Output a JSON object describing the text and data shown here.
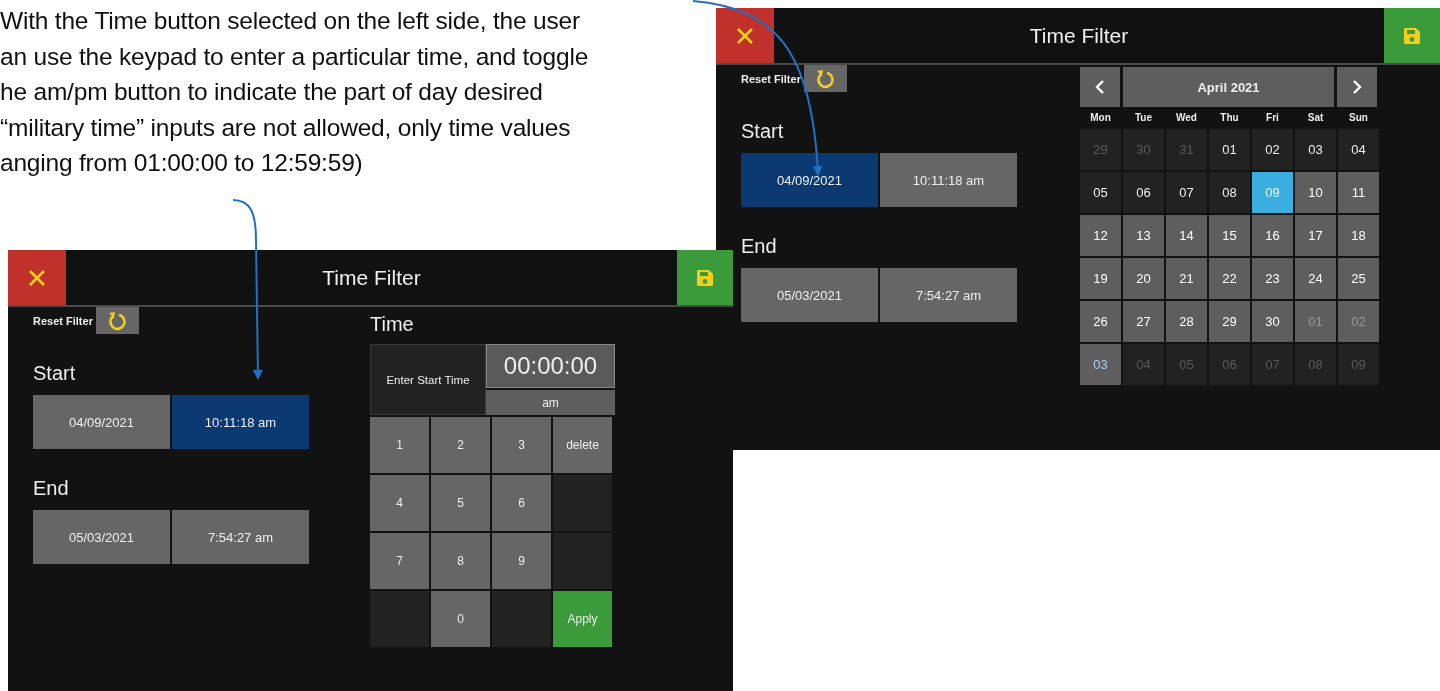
{
  "caption": {
    "lines": [
      "With the Time button selected on the left side, the user",
      "an use the keypad to enter a particular time, and toggle",
      "he am/pm button to indicate the part of day desired",
      "“military time” inputs are not allowed, only time values",
      "anging from 01:00:00 to 12:59:59)"
    ]
  },
  "screens": [
    {
      "kind": "calendar",
      "title": "Time Filter",
      "reset_label": "Reset Filter",
      "start_label": "Start",
      "start": {
        "date": {
          "text": "04/09/2021",
          "selected": true
        },
        "time": {
          "text": "10:11:18 am",
          "selected": false
        }
      },
      "end_label": "End",
      "end": {
        "date": {
          "text": "05/03/2021",
          "selected": false
        },
        "time": {
          "text": "7:54:27 am",
          "selected": false
        }
      },
      "calendar": {
        "month": "April 2021",
        "weekdays": [
          "Mon",
          "Tue",
          "Wed",
          "Thu",
          "Fri",
          "Sat",
          "Sun"
        ],
        "days": [
          {
            "label": "29",
            "kind": "outside",
            "selected": false
          },
          {
            "label": "30",
            "kind": "outside",
            "selected": false
          },
          {
            "label": "31",
            "kind": "outside",
            "selected": false
          },
          {
            "label": "01",
            "kind": "before",
            "selected": false
          },
          {
            "label": "02",
            "kind": "before",
            "selected": false
          },
          {
            "label": "03",
            "kind": "before",
            "selected": false
          },
          {
            "label": "04",
            "kind": "before",
            "selected": false
          },
          {
            "label": "05",
            "kind": "before",
            "selected": false
          },
          {
            "label": "06",
            "kind": "before",
            "selected": false
          },
          {
            "label": "07",
            "kind": "before",
            "selected": false
          },
          {
            "label": "08",
            "kind": "before",
            "selected": false
          },
          {
            "label": "09",
            "kind": "range",
            "selected": true
          },
          {
            "label": "10",
            "kind": "range",
            "selected": false
          },
          {
            "label": "11",
            "kind": "range",
            "selected": false
          },
          {
            "label": "12",
            "kind": "range",
            "selected": false
          },
          {
            "label": "13",
            "kind": "range",
            "selected": false
          },
          {
            "label": "14",
            "kind": "range",
            "selected": false
          },
          {
            "label": "15",
            "kind": "range",
            "selected": false
          },
          {
            "label": "16",
            "kind": "range",
            "selected": false
          },
          {
            "label": "17",
            "kind": "range",
            "selected": false
          },
          {
            "label": "18",
            "kind": "range",
            "selected": false
          },
          {
            "label": "19",
            "kind": "range",
            "selected": false
          },
          {
            "label": "20",
            "kind": "range",
            "selected": false
          },
          {
            "label": "21",
            "kind": "range",
            "selected": false
          },
          {
            "label": "22",
            "kind": "range",
            "selected": false
          },
          {
            "label": "23",
            "kind": "range",
            "selected": false
          },
          {
            "label": "24",
            "kind": "range",
            "selected": false
          },
          {
            "label": "25",
            "kind": "range",
            "selected": false
          },
          {
            "label": "26",
            "kind": "range",
            "selected": false
          },
          {
            "label": "27",
            "kind": "range",
            "selected": false
          },
          {
            "label": "28",
            "kind": "range",
            "selected": false
          },
          {
            "label": "29",
            "kind": "range",
            "selected": false
          },
          {
            "label": "30",
            "kind": "range",
            "selected": false
          },
          {
            "label": "01",
            "kind": "range-outside",
            "selected": false
          },
          {
            "label": "02",
            "kind": "range-outside",
            "selected": false
          },
          {
            "label": "03",
            "kind": "range-end",
            "selected": false
          },
          {
            "label": "04",
            "kind": "outside",
            "selected": false
          },
          {
            "label": "05",
            "kind": "outside",
            "selected": false
          },
          {
            "label": "06",
            "kind": "outside",
            "selected": false
          },
          {
            "label": "07",
            "kind": "outside",
            "selected": false
          },
          {
            "label": "08",
            "kind": "outside",
            "selected": false
          },
          {
            "label": "09",
            "kind": "outside",
            "selected": false
          }
        ]
      }
    },
    {
      "kind": "keypad",
      "title": "Time Filter",
      "reset_label": "Reset Filter",
      "start_label": "Start",
      "start": {
        "date": {
          "text": "04/09/2021",
          "selected": false
        },
        "time": {
          "text": "10:11:18 am",
          "selected": true
        }
      },
      "end_label": "End",
      "end": {
        "date": {
          "text": "05/03/2021",
          "selected": false
        },
        "time": {
          "text": "7:54:27 am",
          "selected": false
        }
      },
      "keypad": {
        "heading": "Time",
        "prompt": "Enter Start Time",
        "display": "00:00:00",
        "ampm": "am",
        "keys": [
          {
            "kind": "digit",
            "label": "1"
          },
          {
            "kind": "digit",
            "label": "2"
          },
          {
            "kind": "digit",
            "label": "3"
          },
          {
            "kind": "delete",
            "label": "delete"
          },
          {
            "kind": "digit",
            "label": "4"
          },
          {
            "kind": "digit",
            "label": "5"
          },
          {
            "kind": "digit",
            "label": "6"
          },
          {
            "kind": "blank"
          },
          {
            "kind": "digit",
            "label": "7"
          },
          {
            "kind": "digit",
            "label": "8"
          },
          {
            "kind": "digit",
            "label": "9"
          },
          {
            "kind": "blank"
          },
          {
            "kind": "blank"
          },
          {
            "kind": "digit",
            "label": "0"
          },
          {
            "kind": "blank"
          },
          {
            "kind": "apply",
            "label": "Apply"
          }
        ]
      }
    }
  ]
}
